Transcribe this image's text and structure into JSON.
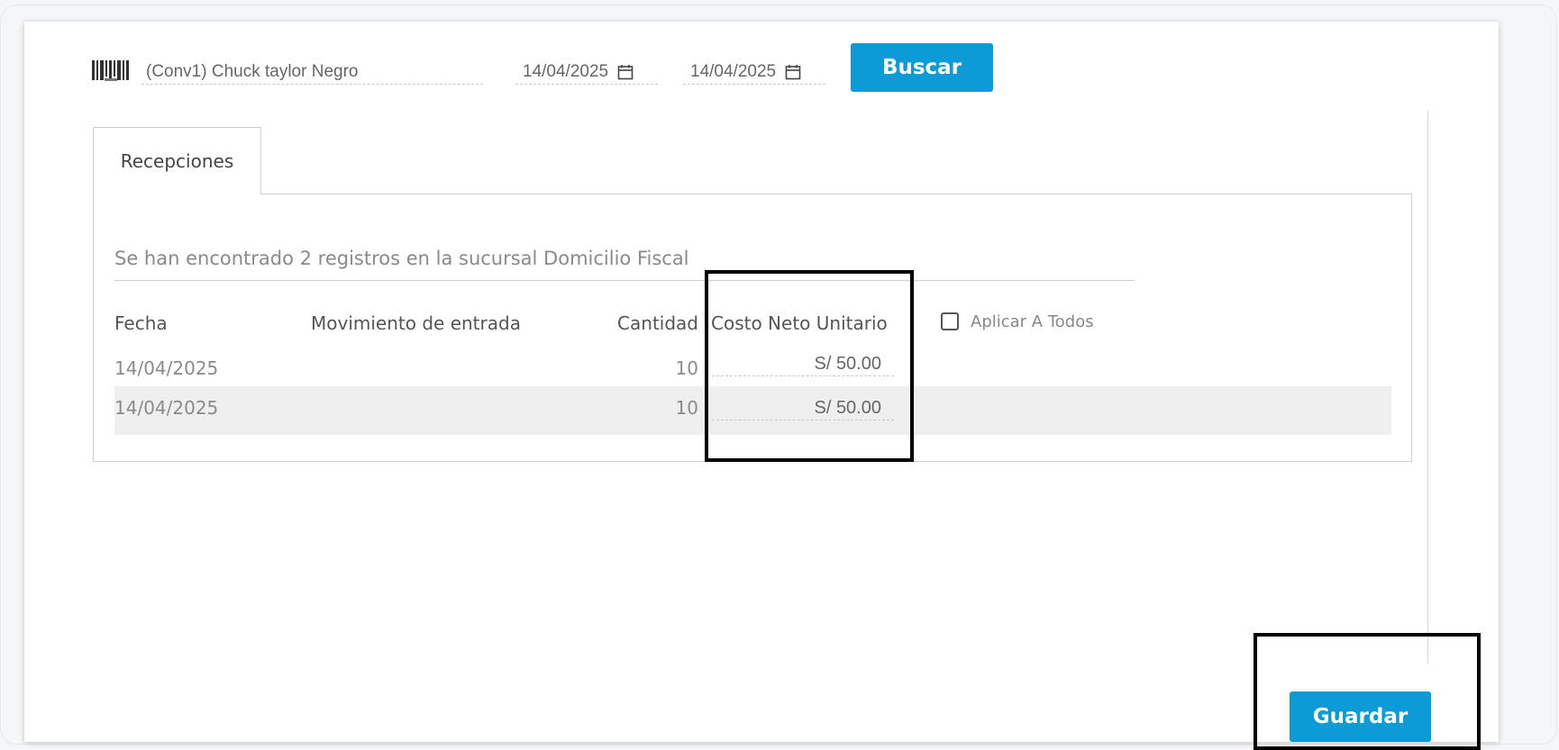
{
  "toolbar": {
    "product": "(Conv1) Chuck taylor Negro",
    "date_from": "14/04/2025",
    "date_to": "14/04/2025",
    "search_label": "Buscar"
  },
  "tabs": [
    {
      "label": "Recepciones"
    }
  ],
  "results": {
    "summary": "Se han encontrado 2 registros en la sucursal Domicilio Fiscal"
  },
  "table": {
    "columns": [
      "Fecha",
      "Movimiento de entrada",
      "Cantidad",
      "Costo Neto Unitario"
    ],
    "apply_all_label": "Aplicar A Todos",
    "rows": [
      {
        "fecha": "14/04/2025",
        "movimiento": "",
        "cantidad": "10",
        "costo": "S/ 50.00"
      },
      {
        "fecha": "14/04/2025",
        "movimiento": "",
        "cantidad": "10",
        "costo": "S/ 50.00"
      }
    ]
  },
  "footer": {
    "save_label": "Guardar"
  },
  "colors": {
    "primary": "#0b9bd6",
    "row_alt": "#efefef"
  }
}
